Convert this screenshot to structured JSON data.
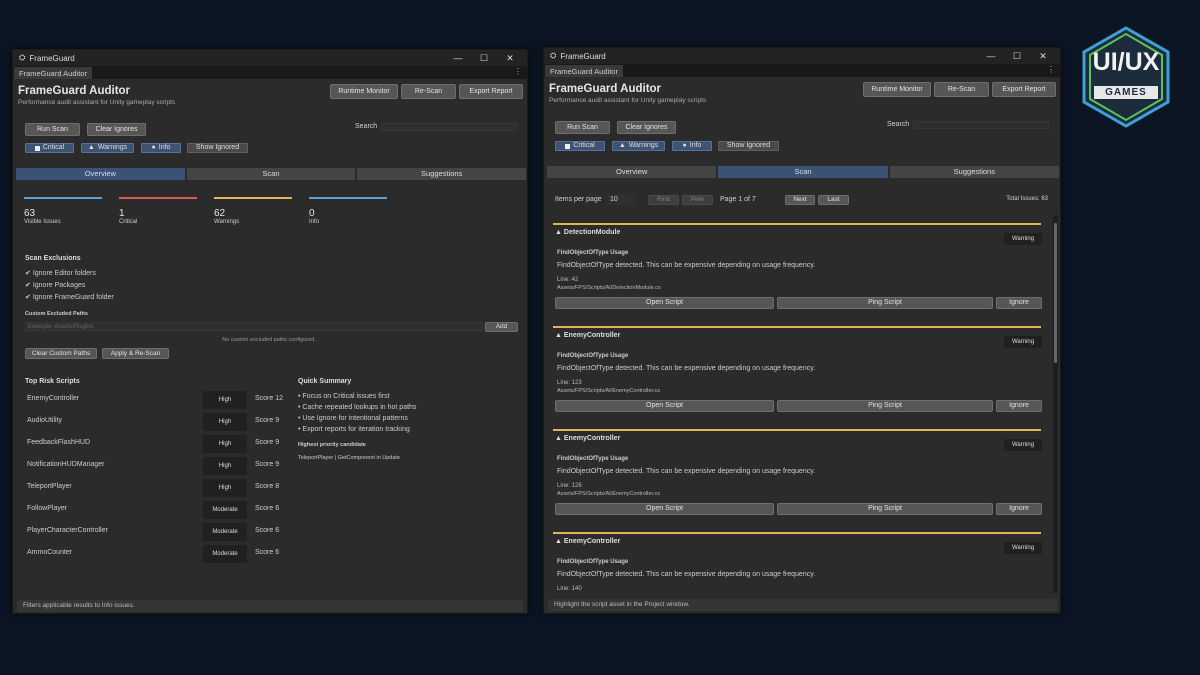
{
  "left": {
    "window_title": "FrameGuard",
    "tab": "FrameGuard Auditor",
    "app_title": "FrameGuard Auditor",
    "subtitle": "Performance audit assistant for Unity gameplay scripts",
    "buttons": {
      "runtime": "Runtime Monitor",
      "rescan": "Re-Scan",
      "export": "Export Report",
      "run": "Run Scan",
      "clear_ignores": "Clear Ignores"
    },
    "search_label": "Search",
    "filters": {
      "critical": "Critical",
      "warnings": "Warnings",
      "info": "Info",
      "show_ignored": "Show Ignored"
    },
    "tabs": [
      "Overview",
      "Scan",
      "Suggestions"
    ],
    "stats": [
      {
        "value": "63",
        "label": "Visible Issues",
        "color": "#5aa3d8"
      },
      {
        "value": "1",
        "label": "Critical",
        "color": "#d9595a"
      },
      {
        "value": "62",
        "label": "Warnings",
        "color": "#e0b552"
      },
      {
        "value": "0",
        "label": "Info",
        "color": "#5aa3d8"
      }
    ],
    "exclusions_title": "Scan Exclusions",
    "exclusions": [
      "Ignore Editor folders",
      "Ignore Packages",
      "Ignore FrameGuard folder"
    ],
    "custom_paths_label": "Custom Excluded Paths",
    "path_placeholder": "Example: Assets/Plugins",
    "add": "Add",
    "no_paths": "No custom excluded paths configured.",
    "clear_paths": "Clear Custom Paths",
    "apply": "Apply & Re-Scan",
    "risk_title": "Top Risk Scripts",
    "risks": [
      {
        "name": "EnemyController",
        "level": "High",
        "score": "Score 12"
      },
      {
        "name": "AudioUtility",
        "level": "High",
        "score": "Score 9"
      },
      {
        "name": "FeedbackFlashHUD",
        "level": "High",
        "score": "Score 9"
      },
      {
        "name": "NotificationHUDManager",
        "level": "High",
        "score": "Score 9"
      },
      {
        "name": "TeleportPlayer",
        "level": "High",
        "score": "Score 8"
      },
      {
        "name": "FollowPlayer",
        "level": "Moderate",
        "score": "Score 6"
      },
      {
        "name": "PlayerCharacterController",
        "level": "Moderate",
        "score": "Score 6"
      },
      {
        "name": "AmmoCounter",
        "level": "Moderate",
        "score": "Score 6"
      }
    ],
    "quick_title": "Quick Summary",
    "quick": [
      "• Focus on Critical issues first",
      "• Cache repeated lookups in hot paths",
      "• Use Ignore for intentional patterns",
      "• Export reports for iteration tracking"
    ],
    "priority_label": "Highest priority candidate",
    "priority_value": "TeleportPlayer | GetComponent in Update",
    "status": "Filters applicable results to Info issues."
  },
  "right": {
    "window_title": "FrameGuard",
    "tab": "FrameGuard Auditor",
    "app_title": "FrameGuard Auditor",
    "subtitle": "Performance audit assistant for Unity gameplay scripts",
    "buttons": {
      "runtime": "Runtime Monitor",
      "rescan": "Re-Scan",
      "export": "Export Report",
      "run": "Run Scan",
      "clear_ignores": "Clear Ignores"
    },
    "search_label": "Search",
    "filters": {
      "critical": "Critical",
      "warnings": "Warnings",
      "info": "Info",
      "show_ignored": "Show Ignored"
    },
    "tabs": [
      "Overview",
      "Scan",
      "Suggestions"
    ],
    "items_per_page_label": "Items per page",
    "items_per_page": "10",
    "pager": {
      "first": "First",
      "prev": "Prev",
      "page": "Page 1 of 7",
      "next": "Next",
      "last": "Last"
    },
    "total": "Total Issues: 63",
    "issues": [
      {
        "title": "DetectionModule",
        "severity": "Warning",
        "type": "FindObjectOfType Usage",
        "message": "FindObjectOfType detected. This can be expensive depending on usage frequency.",
        "line": "Line: 42",
        "path": "Assets/FPS/Scripts/AI/DetectionModule.cs"
      },
      {
        "title": "EnemyController",
        "severity": "Warning",
        "type": "FindObjectOfType Usage",
        "message": "FindObjectOfType detected. This can be expensive depending on usage frequency.",
        "line": "Line: 123",
        "path": "Assets/FPS/Scripts/AI/EnemyController.cs"
      },
      {
        "title": "EnemyController",
        "severity": "Warning",
        "type": "FindObjectOfType Usage",
        "message": "FindObjectOfType detected. This can be expensive depending on usage frequency.",
        "line": "Line: 126",
        "path": "Assets/FPS/Scripts/AI/EnemyController.cs"
      },
      {
        "title": "EnemyController",
        "severity": "Warning",
        "type": "FindObjectOfType Usage",
        "message": "FindObjectOfType detected. This can be expensive depending on usage frequency.",
        "line": "Line: 140",
        "path": ""
      }
    ],
    "open_script": "Open Script",
    "ping_script": "Ping Script",
    "ignore": "Ignore",
    "status": "Highlight the script asset in the Project window."
  },
  "logo": {
    "line1": "UI/UX",
    "line2": "GAMES"
  }
}
